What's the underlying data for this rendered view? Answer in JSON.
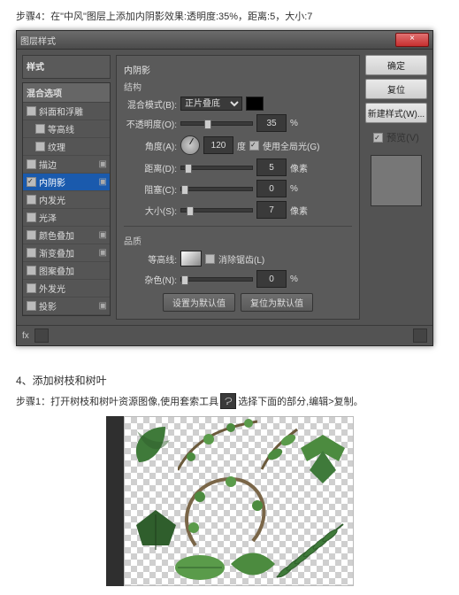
{
  "instructions": {
    "step4": "步骤4：在\"中风\"图层上添加内阴影效果:透明度:35%，距离:5，大小:7"
  },
  "dialog": {
    "title": "图层样式",
    "styles_header": "样式",
    "blend_header": "混合选项",
    "effects": [
      {
        "label": "斜面和浮雕",
        "checked": false,
        "plus": false
      },
      {
        "label": "等高线",
        "checked": false,
        "plus": false,
        "indent": true
      },
      {
        "label": "纹理",
        "checked": false,
        "plus": false,
        "indent": true
      },
      {
        "label": "描边",
        "checked": false,
        "plus": true
      },
      {
        "label": "内阴影",
        "checked": true,
        "plus": true,
        "selected": true
      },
      {
        "label": "内发光",
        "checked": false,
        "plus": false
      },
      {
        "label": "光泽",
        "checked": false,
        "plus": false
      },
      {
        "label": "颜色叠加",
        "checked": false,
        "plus": true
      },
      {
        "label": "渐变叠加",
        "checked": false,
        "plus": true
      },
      {
        "label": "图案叠加",
        "checked": false,
        "plus": false
      },
      {
        "label": "外发光",
        "checked": false,
        "plus": false
      },
      {
        "label": "投影",
        "checked": false,
        "plus": true
      }
    ],
    "panel": {
      "title": "内阴影",
      "structure": "结构",
      "blend_label": "混合模式(B):",
      "blend_value": "正片叠底",
      "opacity_label": "不透明度(O):",
      "opacity_value": "35",
      "angle_label": "角度(A):",
      "angle_value": "120",
      "global_light": "使用全局光(G)",
      "distance_label": "距离(D):",
      "distance_value": "5",
      "distance_unit": "像素",
      "choke_label": "阻塞(C):",
      "choke_value": "0",
      "choke_unit": "%",
      "size_label": "大小(S):",
      "size_value": "7",
      "size_unit": "像素",
      "quality": "品质",
      "contour_label": "等高线:",
      "antialias": "消除锯齿(L)",
      "noise_label": "杂色(N):",
      "noise_value": "0",
      "noise_unit": "%",
      "make_default": "设置为默认值",
      "reset_default": "复位为默认值",
      "pct": "%",
      "deg": "度"
    },
    "buttons": {
      "ok": "确定",
      "cancel": "复位",
      "new_style": "新建样式(W)...",
      "preview": "预览(V)"
    },
    "footer_fx": "fx"
  },
  "section4": {
    "heading": "4、添加树枝和树叶",
    "step1_a": "步骤1：打开树枝和树叶资源图像,使用套索工具",
    "step1_b": "选择下面的部分,编辑>复制。",
    "lasso_icon": "lasso-icon"
  }
}
